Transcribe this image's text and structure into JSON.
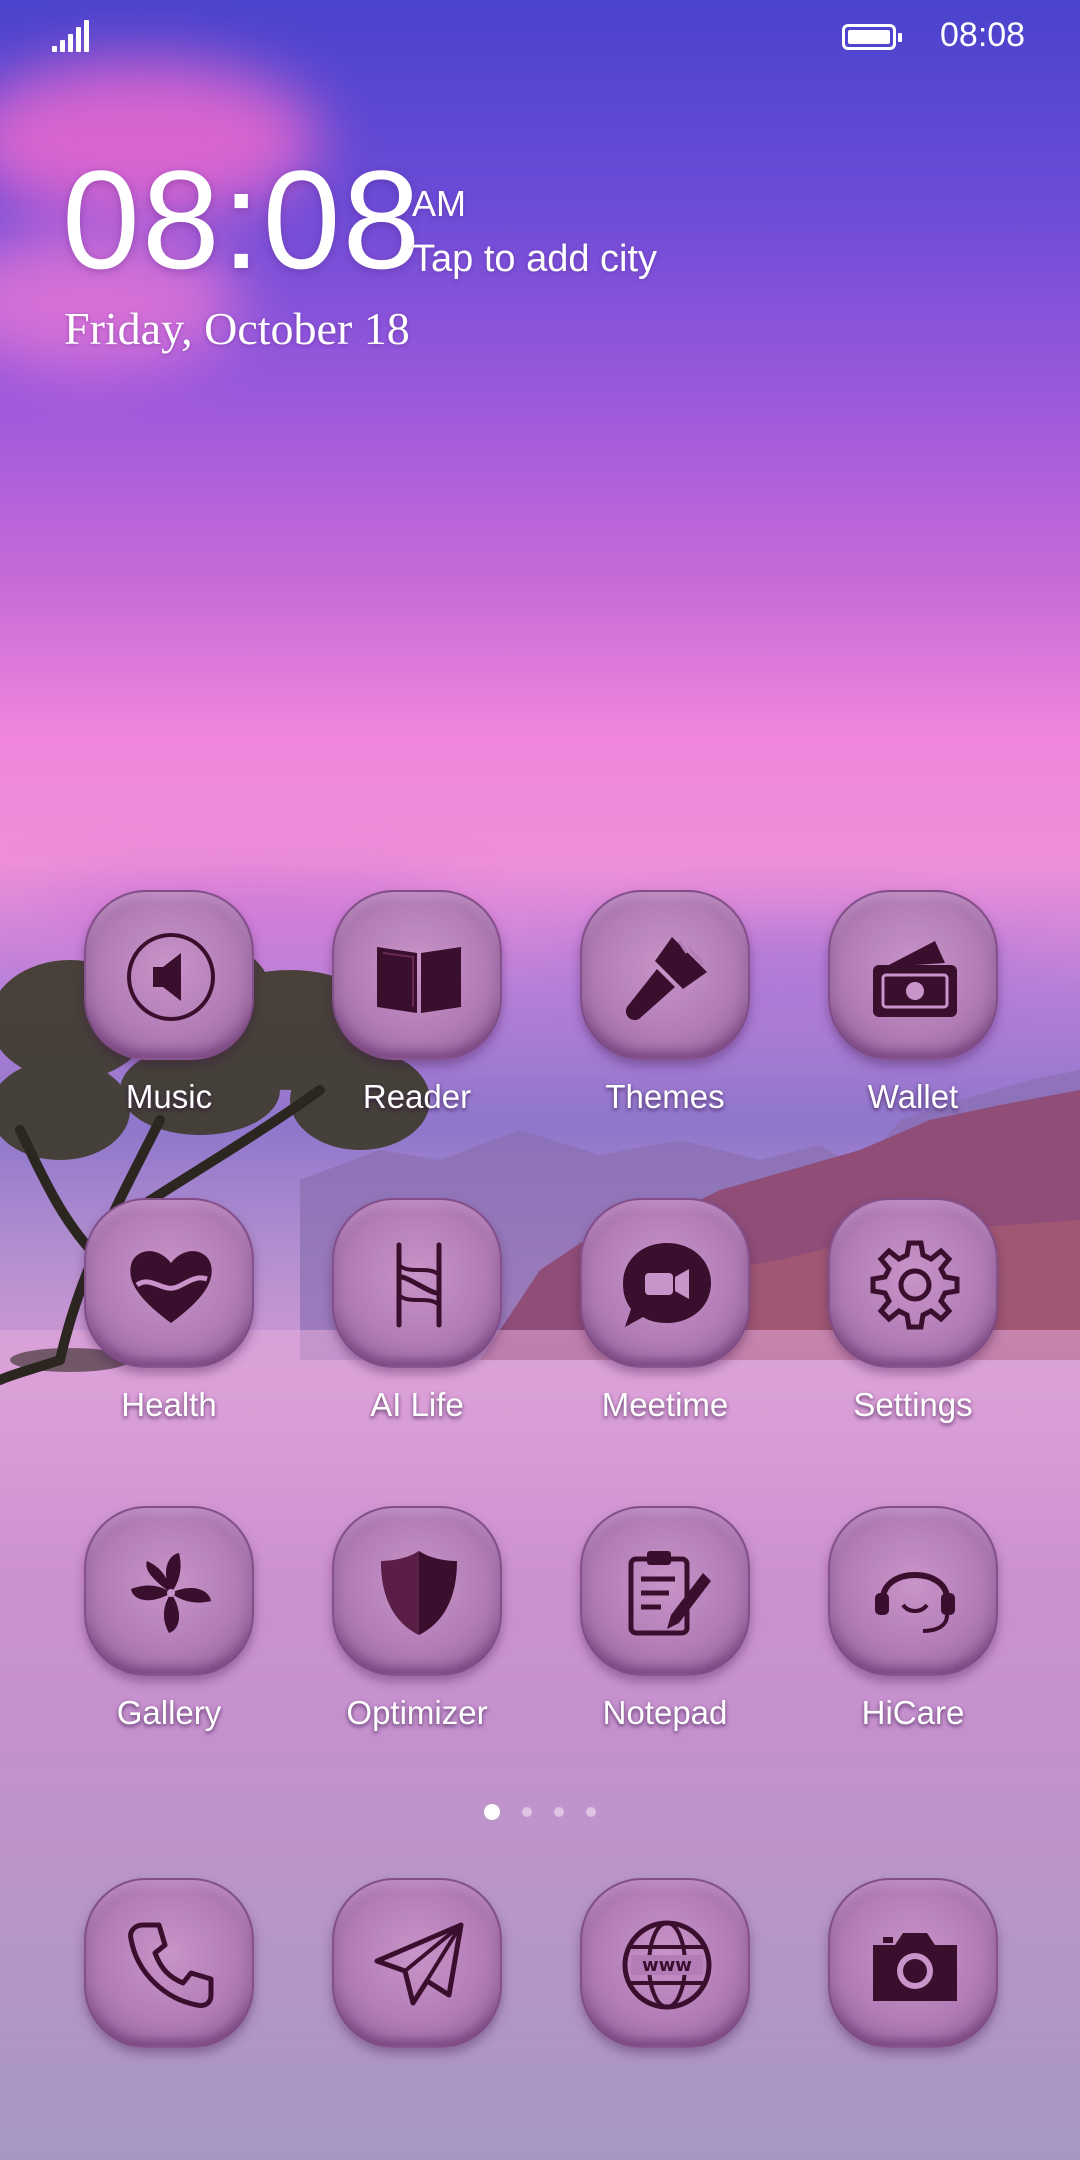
{
  "status_bar": {
    "time": "08:08",
    "battery_icon": "battery-full-icon",
    "signal_icon": "signal-icon"
  },
  "clock_widget": {
    "time": "08:08",
    "ampm": "AM",
    "city_prompt": "Tap to add city",
    "date": "Friday, October 18"
  },
  "apps": [
    {
      "label": "Music",
      "icon": "speaker-icon"
    },
    {
      "label": "Reader",
      "icon": "book-icon"
    },
    {
      "label": "Themes",
      "icon": "brush-icon"
    },
    {
      "label": "Wallet",
      "icon": "wallet-icon"
    },
    {
      "label": "Health",
      "icon": "heart-icon"
    },
    {
      "label": "AI Life",
      "icon": "ai-life-icon"
    },
    {
      "label": "Meetime",
      "icon": "video-chat-icon"
    },
    {
      "label": "Settings",
      "icon": "gear-icon"
    },
    {
      "label": "Gallery",
      "icon": "flower-icon"
    },
    {
      "label": "Optimizer",
      "icon": "shield-icon"
    },
    {
      "label": "Notepad",
      "icon": "notepad-icon"
    },
    {
      "label": "HiCare",
      "icon": "headset-icon"
    }
  ],
  "page_indicator": {
    "current": 1,
    "total": 4
  },
  "dock": [
    {
      "name": "phone",
      "icon": "phone-icon"
    },
    {
      "name": "messages",
      "icon": "paper-plane-icon"
    },
    {
      "name": "browser",
      "icon": "globe-www-icon"
    },
    {
      "name": "camera",
      "icon": "camera-icon"
    }
  ],
  "colors": {
    "icon_glyph": "#3a0f2e",
    "tile": "#b57fb8",
    "sky_top": "#4a43cc",
    "sky_pink": "#ef86dc"
  }
}
